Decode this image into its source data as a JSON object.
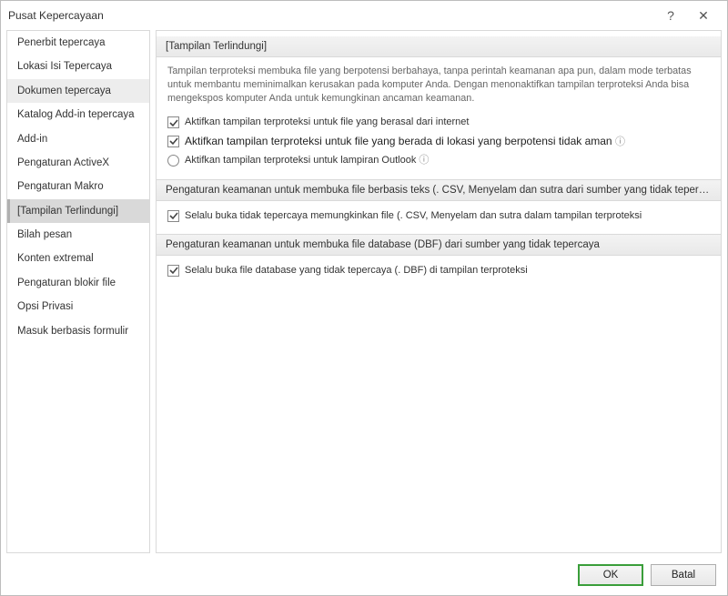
{
  "window": {
    "title": "Pusat Kepercayaan",
    "help_label": "?",
    "close_label": "✕"
  },
  "sidebar": {
    "items": [
      {
        "label": "Penerbit tepercaya"
      },
      {
        "label": "Lokasi Isi Tepercaya"
      },
      {
        "label": "Dokumen tepercaya"
      },
      {
        "label": "Katalog Add-in tepercaya"
      },
      {
        "label": "Add-in"
      },
      {
        "label": "Pengaturan ActiveX"
      },
      {
        "label": "Pengaturan Makro"
      },
      {
        "label": "[Tampilan Terlindungi]"
      },
      {
        "label": "Bilah pesan"
      },
      {
        "label": "Konten extremal"
      },
      {
        "label": "Pengaturan blokir file"
      },
      {
        "label": "Opsi Privasi"
      },
      {
        "label": "Masuk berbasis formulir"
      }
    ]
  },
  "main": {
    "section1": {
      "header": "[Tampilan Terlindungi]",
      "description": "Tampilan terproteksi membuka file yang berpotensi berbahaya, tanpa perintah keamanan apa pun, dalam mode terbatas untuk membantu meminimalkan kerusakan pada komputer Anda. Dengan menonaktifkan tampilan terproteksi Anda bisa mengekspos komputer Anda untuk kemungkinan ancaman keamanan.",
      "opt1": "Aktifkan tampilan terproteksi untuk file yang berasal dari internet",
      "opt2": "Aktifkan tampilan terproteksi untuk file yang berada di lokasi yang berpotensi tidak aman",
      "opt2_info": "ⓘ",
      "opt3": "Aktifkan tampilan terproteksi untuk lampiran Outlook",
      "opt3_info": "ⓘ"
    },
    "section2": {
      "header": "Pengaturan keamanan untuk membuka file berbasis teks (. CSV, Menyelam dan sutra dari sumber yang tidak tepercaya",
      "opt1": "Selalu buka tidak tepercaya memungkinkan file (. CSV, Menyelam dan sutra dalam tampilan terproteksi"
    },
    "section3": {
      "header": "Pengaturan keamanan untuk membuka file database (DBF) dari sumber yang tidak tepercaya",
      "opt1": "Selalu buka file database yang tidak tepercaya (. DBF) di tampilan terproteksi"
    }
  },
  "footer": {
    "ok": "OK",
    "cancel": "Batal"
  }
}
